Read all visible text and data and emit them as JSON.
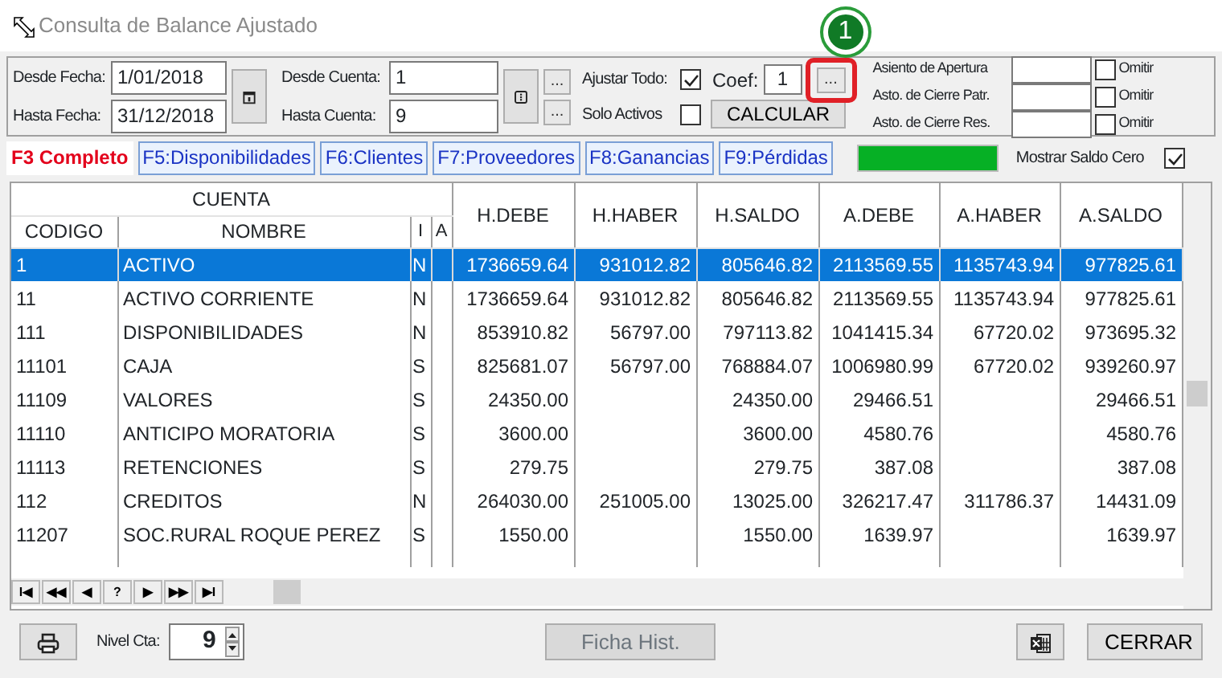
{
  "window": {
    "title": "Consulta de Balance Ajustado"
  },
  "filters": {
    "desde_fecha_label": "Desde Fecha:",
    "desde_fecha": "1/01/2018",
    "hasta_fecha_label": "Hasta Fecha:",
    "hasta_fecha": "31/12/2018",
    "desde_cuenta_label": "Desde Cuenta:",
    "desde_cuenta": "1",
    "hasta_cuenta_label": "Hasta Cuenta:",
    "hasta_cuenta": "9",
    "browse_1": "...",
    "browse_2": "...",
    "ajustar_label": "Ajustar Todo:",
    "ajustar_checked": true,
    "coef_label": "Coef:",
    "coef": "1",
    "coef_browse": "...",
    "solo_label": "Solo Activos",
    "solo_checked": false,
    "calcular": "CALCULAR"
  },
  "asientos": [
    {
      "label": "Asiento de Apertura",
      "omit_label": "Omitir",
      "checked": false
    },
    {
      "label": "Asto. de Cierre Patr.",
      "omit_label": "Omitir",
      "checked": false
    },
    {
      "label": "Asto. de Cierre Res.",
      "omit_label": "Omitir",
      "checked": false
    }
  ],
  "callout": {
    "number": "1"
  },
  "tabs": [
    {
      "label": "F3 Completo",
      "selected": true
    },
    {
      "label": "F5:Disponibilidades",
      "selected": false
    },
    {
      "label": "F6:Clientes",
      "selected": false
    },
    {
      "label": "F7:Proveedores",
      "selected": false
    },
    {
      "label": "F8:Ganancias",
      "selected": false
    },
    {
      "label": "F9:Pérdidas",
      "selected": false
    }
  ],
  "progress": {
    "level": 1
  },
  "mostrar": {
    "label": "Mostrar Saldo Cero",
    "checked": true
  },
  "table": {
    "group": "CUENTA",
    "columns": [
      "CODIGO",
      "NOMBRE",
      "I",
      "A",
      "H.DEBE",
      "H.HABER",
      "H.SALDO",
      "A.DEBE",
      "A.HABER",
      "A.SALDO"
    ],
    "rows": [
      {
        "cells": [
          "1",
          "ACTIVO",
          "N",
          "",
          "1736659.64",
          "931012.82",
          "805646.82",
          "2113569.55",
          "1135743.94",
          "977825.61"
        ],
        "selected": true
      },
      {
        "cells": [
          "11",
          "ACTIVO CORRIENTE",
          "N",
          "",
          "1736659.64",
          "931012.82",
          "805646.82",
          "2113569.55",
          "1135743.94",
          "977825.61"
        ],
        "selected": false
      },
      {
        "cells": [
          "111",
          "DISPONIBILIDADES",
          "N",
          "",
          "853910.82",
          "56797.00",
          "797113.82",
          "1041415.34",
          "67720.02",
          "973695.32"
        ],
        "selected": false
      },
      {
        "cells": [
          "11101",
          "CAJA",
          "S",
          "",
          "825681.07",
          "56797.00",
          "768884.07",
          "1006980.99",
          "67720.02",
          "939260.97"
        ],
        "selected": false
      },
      {
        "cells": [
          "11109",
          "VALORES",
          "S",
          "",
          "24350.00",
          "",
          "24350.00",
          "29466.51",
          "",
          "29466.51"
        ],
        "selected": false
      },
      {
        "cells": [
          "11110",
          "ANTICIPO MORATORIA",
          "S",
          "",
          "3600.00",
          "",
          "3600.00",
          "4580.76",
          "",
          "4580.76"
        ],
        "selected": false
      },
      {
        "cells": [
          "11113",
          "RETENCIONES",
          "S",
          "",
          "279.75",
          "",
          "279.75",
          "387.08",
          "",
          "387.08"
        ],
        "selected": false
      },
      {
        "cells": [
          "112",
          "CREDITOS",
          "N",
          "",
          "264030.00",
          "251005.00",
          "13025.00",
          "326217.47",
          "311786.37",
          "14431.09"
        ],
        "selected": false
      },
      {
        "cells": [
          "11207",
          "SOC.RURAL ROQUE PEREZ",
          "S",
          "",
          "1550.00",
          "",
          "1550.00",
          "1639.97",
          "",
          "1639.97"
        ],
        "selected": false
      }
    ]
  },
  "navigator": [
    "I◀",
    "◀◀",
    "◀",
    "?",
    "▶",
    "▶▶",
    "▶I"
  ],
  "footer": {
    "nivel_label": "Nivel Cta:",
    "nivel": "9",
    "ficha": "Ficha Hist.",
    "ficha_disabled": true,
    "cerrar": "CERRAR"
  }
}
